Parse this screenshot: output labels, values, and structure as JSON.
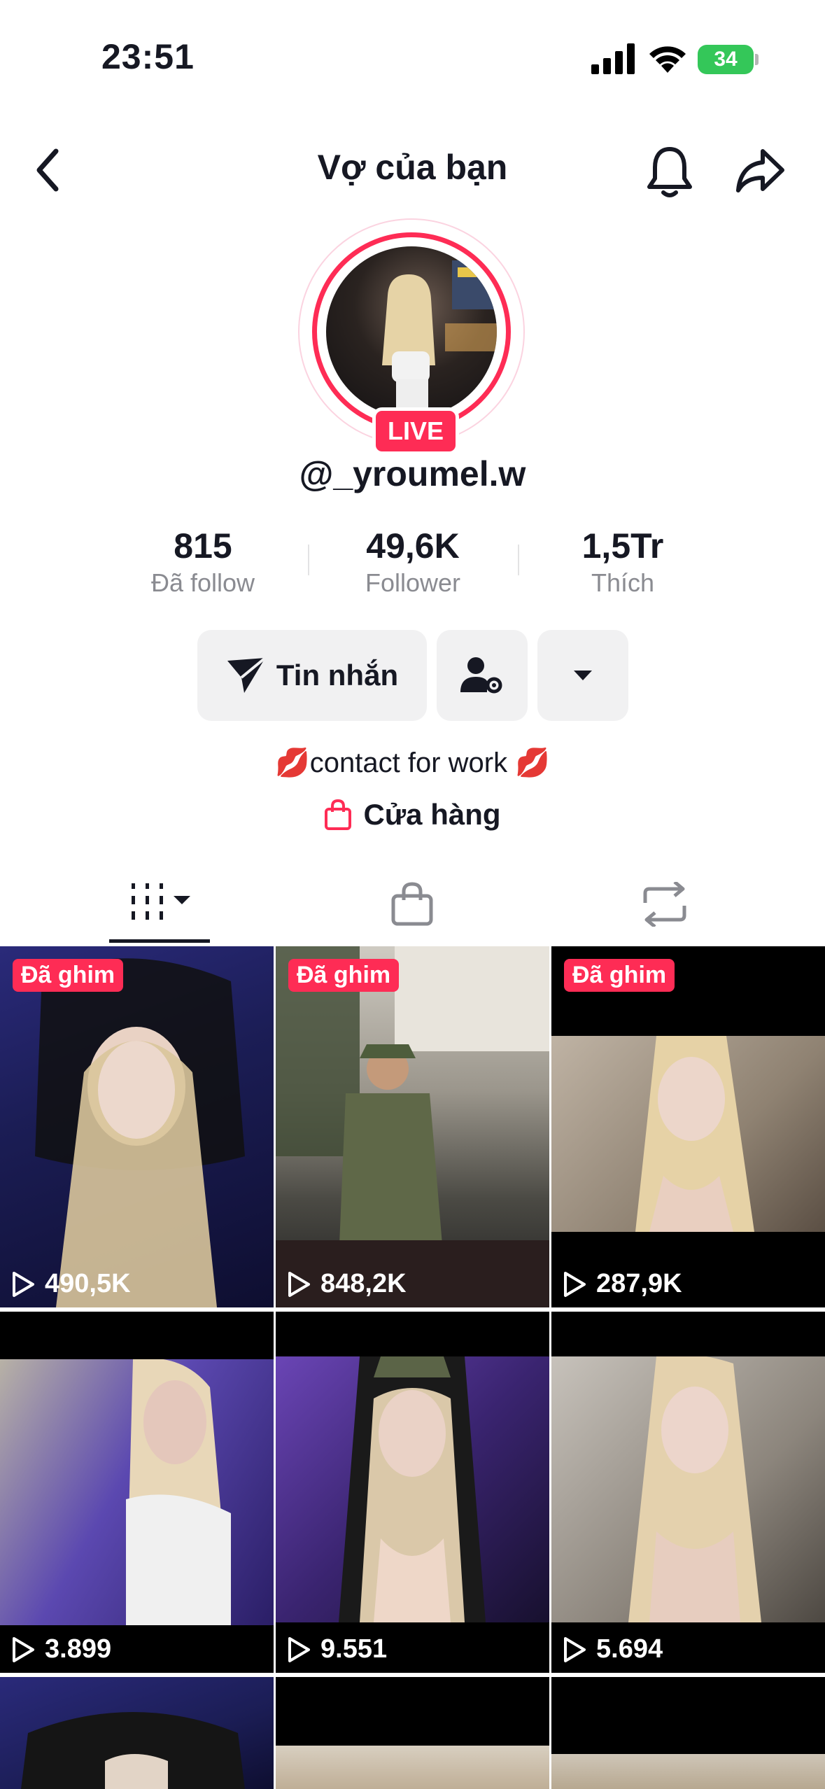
{
  "status_bar": {
    "time": "23:51",
    "battery": "34"
  },
  "header": {
    "title": "Vợ của bạn"
  },
  "profile": {
    "live_badge": "LIVE",
    "username": "@_yroumel.w"
  },
  "stats": [
    {
      "value": "815",
      "label": "Đã follow"
    },
    {
      "value": "49,6K",
      "label": "Follower"
    },
    {
      "value": "1,5Tr",
      "label": "Thích"
    }
  ],
  "actions": {
    "message_label": "Tin nhắn"
  },
  "bio": {
    "text": "💋contact for work 💋"
  },
  "shop": {
    "label": "Cửa hàng"
  },
  "videos": [
    {
      "pinned_label": "Đã ghim",
      "views": "490,5K"
    },
    {
      "pinned_label": "Đã ghim",
      "views": "848,2K"
    },
    {
      "pinned_label": "Đã ghim",
      "views": "287,9K"
    },
    {
      "views": "3.899"
    },
    {
      "views": "9.551"
    },
    {
      "views": "5.694"
    }
  ],
  "colors": {
    "accent": "#fe2c55",
    "text": "#161823",
    "secondary": "#8a8b91",
    "button_bg": "#f1f1f2",
    "battery": "#34c759"
  },
  "icons": [
    "back-icon",
    "bell-icon",
    "share-icon",
    "send-icon",
    "person-settings-icon",
    "chevron-down-icon",
    "shopping-bag-icon",
    "grid-icon",
    "repost-icon",
    "play-icon"
  ]
}
